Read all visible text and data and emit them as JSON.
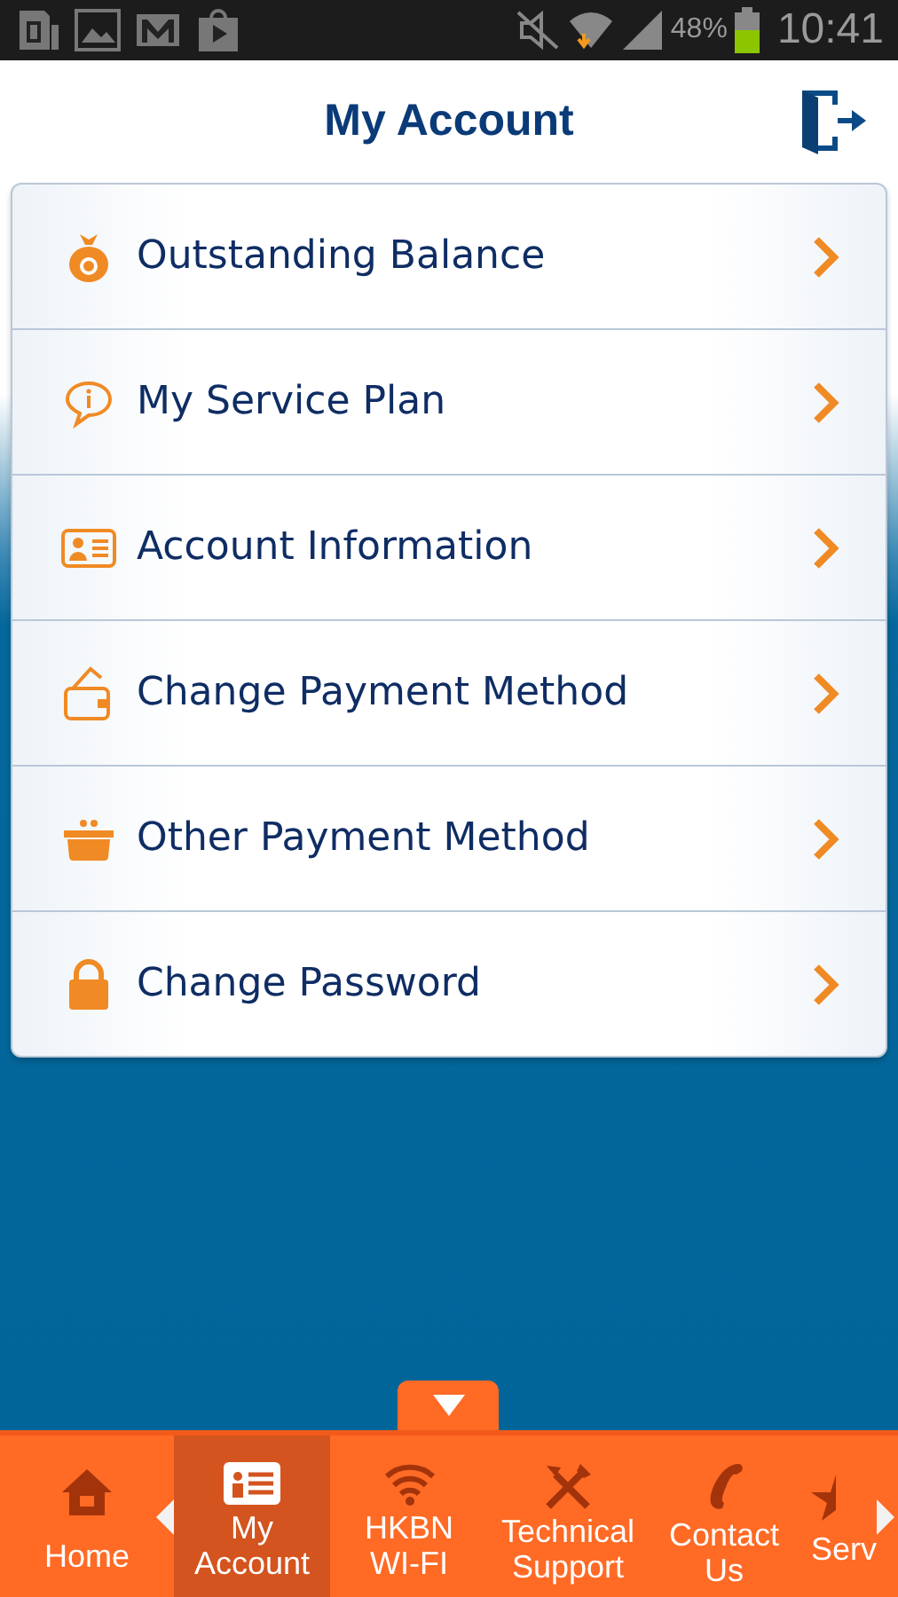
{
  "status_bar": {
    "battery": "48%",
    "time": "10:41"
  },
  "header": {
    "title": "My Account"
  },
  "menu": [
    {
      "label": "Outstanding Balance"
    },
    {
      "label": "My Service Plan"
    },
    {
      "label": "Account Information"
    },
    {
      "label": "Change Payment Method"
    },
    {
      "label": "Other Payment Method"
    },
    {
      "label": "Change Password"
    }
  ],
  "nav": [
    {
      "label": "Home",
      "selected": false
    },
    {
      "label": "My\nAccount",
      "selected": true
    },
    {
      "label": "HKBN\nWI-FI",
      "selected": false
    },
    {
      "label": "Technical\nSupport",
      "selected": false
    },
    {
      "label": "Contact\nUs",
      "selected": false
    },
    {
      "label": "Serv",
      "selected": false
    }
  ]
}
